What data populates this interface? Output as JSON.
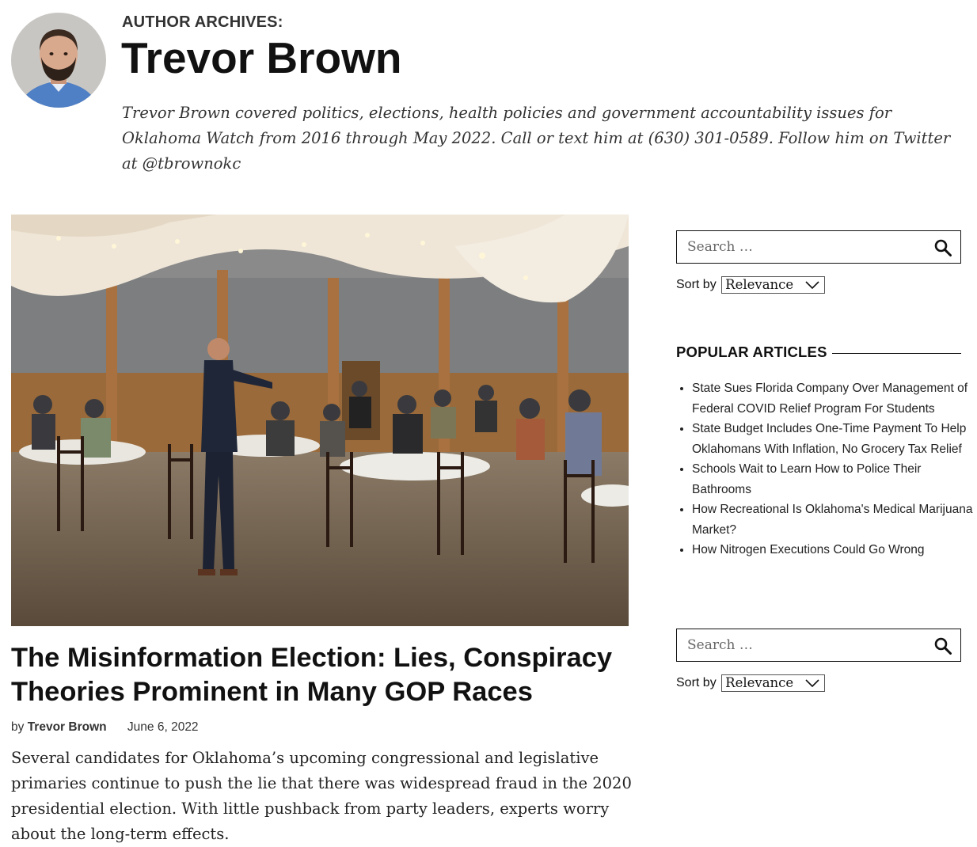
{
  "author": {
    "archive_label": "AUTHOR ARCHIVES:",
    "name": "Trevor Brown",
    "bio": "Trevor Brown covered politics, elections, health policies and government accountability issues for Oklahoma Watch from 2016 through May 2022. Call or text him at (630) 301-0589. Follow him on Twitter at @tbrownokc"
  },
  "article": {
    "title": "The Misinformation Election: Lies, Conspiracy Theories Prominent in Many GOP Races",
    "byline_prefix": "by",
    "byline_author": "Trevor Brown",
    "date": "June 6, 2022",
    "excerpt": "Several candidates for Oklahoma’s upcoming congressional and legislative primaries continue to push the lie that there was widespread fraud in the 2020 presidential election. With little pushback from party leaders, experts worry about the long-term effects."
  },
  "sidebar": {
    "search_top": {
      "placeholder": "Search …",
      "icon": "search-icon"
    },
    "sort_top": {
      "label": "Sort by",
      "selected": "Relevance"
    },
    "popular": {
      "heading": "POPULAR ARTICLES",
      "items": [
        "State Sues Florida Company Over Management of Federal COVID Relief Program For Students",
        "State Budget Includes One-Time Payment To Help Oklahomans With Inflation, No Grocery Tax Relief",
        "Schools Wait to Learn How to Police Their Bathrooms",
        "How Recreational Is Oklahoma's Medical Marijuana Market?",
        "How Nitrogen Executions Could Go Wrong"
      ]
    },
    "search_bottom": {
      "placeholder": "Search …",
      "icon": "search-icon"
    },
    "sort_bottom": {
      "label": "Sort by",
      "selected": "Relevance"
    }
  },
  "colors": {
    "text": "#111111",
    "rule": "#111111",
    "border": "#111111"
  }
}
